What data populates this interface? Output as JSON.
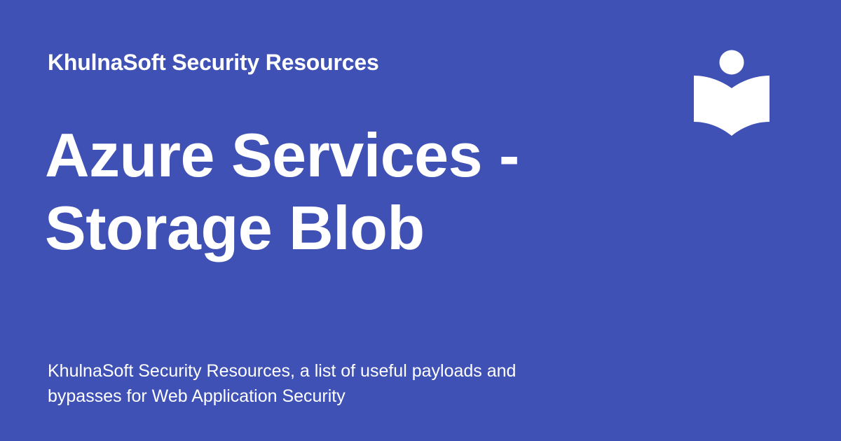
{
  "card": {
    "site_name": "KhulnaSoft Security Resources",
    "title_lines": [
      "Azure Services -",
      "Storage Blob"
    ],
    "description_lines": [
      "KhulnaSoft Security Resources, a list of useful payloads and",
      "bypasses for Web Application Security"
    ],
    "logo_icon": "book-reader-icon",
    "colors": {
      "background": "#3f51b5",
      "text": "#ffffff"
    }
  }
}
